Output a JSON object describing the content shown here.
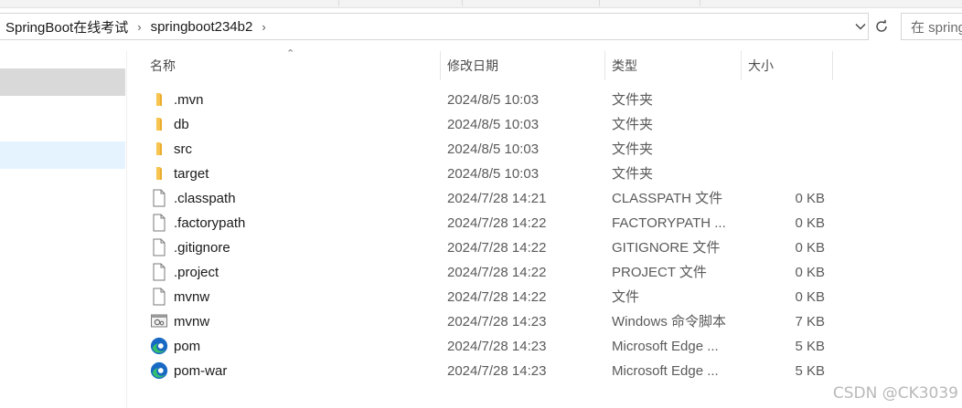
{
  "address": {
    "crumbs": [
      "SpringBoot在线考试",
      "springboot234b2"
    ],
    "separator": "›",
    "dropdown_icon": "chevron-down-icon",
    "refresh_icon": "refresh-icon"
  },
  "search": {
    "text": "在 spring"
  },
  "columns": {
    "name": "名称",
    "date": "修改日期",
    "type": "类型",
    "size": "大小"
  },
  "files": [
    {
      "icon": "folder-icon",
      "name": ".mvn",
      "date": "2024/8/5 10:03",
      "type": "文件夹",
      "size": ""
    },
    {
      "icon": "folder-icon",
      "name": "db",
      "date": "2024/8/5 10:03",
      "type": "文件夹",
      "size": ""
    },
    {
      "icon": "folder-icon",
      "name": "src",
      "date": "2024/8/5 10:03",
      "type": "文件夹",
      "size": ""
    },
    {
      "icon": "folder-icon",
      "name": "target",
      "date": "2024/8/5 10:03",
      "type": "文件夹",
      "size": ""
    },
    {
      "icon": "file-icon",
      "name": ".classpath",
      "date": "2024/7/28 14:21",
      "type": "CLASSPATH 文件",
      "size": "0 KB"
    },
    {
      "icon": "file-icon",
      "name": ".factorypath",
      "date": "2024/7/28 14:22",
      "type": "FACTORYPATH ...",
      "size": "0 KB"
    },
    {
      "icon": "file-icon",
      "name": ".gitignore",
      "date": "2024/7/28 14:22",
      "type": "GITIGNORE 文件",
      "size": "0 KB"
    },
    {
      "icon": "file-icon",
      "name": ".project",
      "date": "2024/7/28 14:22",
      "type": "PROJECT 文件",
      "size": "0 KB"
    },
    {
      "icon": "file-icon",
      "name": "mvnw",
      "date": "2024/7/28 14:22",
      "type": "文件",
      "size": "0 KB"
    },
    {
      "icon": "cmd-script-icon",
      "name": "mvnw",
      "date": "2024/7/28 14:23",
      "type": "Windows 命令脚本",
      "size": "7 KB"
    },
    {
      "icon": "edge-icon",
      "name": "pom",
      "date": "2024/7/28 14:23",
      "type": "Microsoft Edge ...",
      "size": "5 KB"
    },
    {
      "icon": "edge-icon",
      "name": "pom-war",
      "date": "2024/7/28 14:23",
      "type": "Microsoft Edge ...",
      "size": "5 KB"
    }
  ],
  "colors": {
    "folder": "#f8c44f",
    "edge_blue": "#1769c4",
    "edge_green": "#34c06b",
    "nav_selected": "#d9d9d9",
    "nav_hover": "#e5f3ff"
  },
  "watermark": "CSDN @CK3039"
}
